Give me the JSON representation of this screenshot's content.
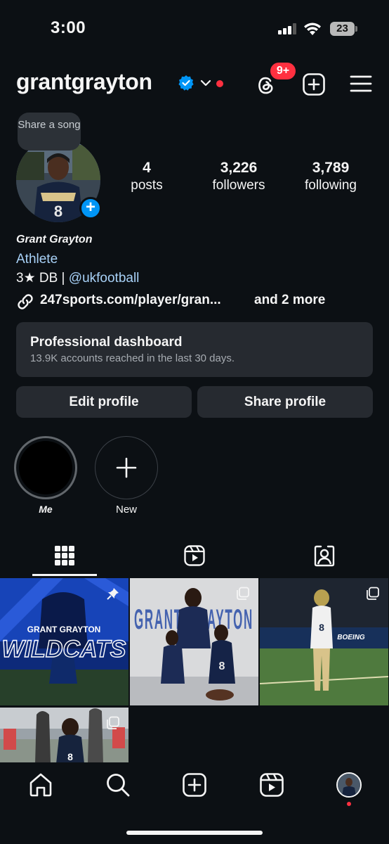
{
  "status_bar": {
    "time": "3:00",
    "battery": "23"
  },
  "header": {
    "username": "grantgrayton",
    "notification_count": "9+"
  },
  "profile": {
    "share_song": "Share a song",
    "stats": [
      {
        "value": "4",
        "label": "posts"
      },
      {
        "value": "3,226",
        "label": "followers"
      },
      {
        "value": "3,789",
        "label": "following"
      }
    ],
    "full_name": "Grant Grayton",
    "category": "Athlete",
    "bio_prefix": "3★ DB | ",
    "bio_handle": "@ukfootball",
    "link_text": "247sports.com/player/gran...",
    "link_more": "and 2 more"
  },
  "dashboard": {
    "title": "Professional dashboard",
    "subtitle": "13.9K accounts reached in the last 30 days."
  },
  "buttons": {
    "edit_profile": "Edit profile",
    "share_profile": "Share profile"
  },
  "highlights": [
    {
      "label": "Me"
    },
    {
      "label": "New"
    }
  ],
  "posts": [
    {
      "caption": "GRANT GRAYTON",
      "title": "WILDCATS"
    },
    {
      "caption": "GRANT GRAYTON"
    },
    {
      "caption": "BOEING"
    },
    {
      "caption": ""
    }
  ],
  "colors": {
    "background": "#0c1014",
    "accent": "#0095f6",
    "badge": "#ff3040",
    "link": "#a8d1f7"
  }
}
